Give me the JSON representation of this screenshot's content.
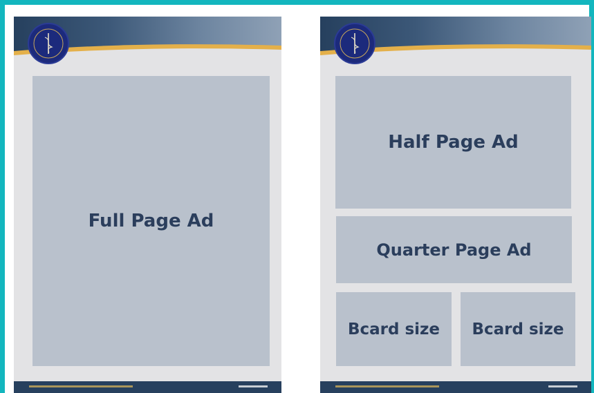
{
  "ads": {
    "full_page": "Full Page Ad",
    "half_page": "Half Page Ad",
    "quarter_page": "Quarter Page Ad",
    "bcard_left": "Bcard size",
    "bcard_right": "Bcard size"
  },
  "colors": {
    "frame": "#13b6be",
    "header_dark": "#26405e",
    "accent_gold": "#e4b04a",
    "ad_fill": "#b9c1cc",
    "ad_text": "#2b3e5c",
    "logo": "#1c2a7c"
  },
  "icons": {
    "logo": "medical-staff-logo-icon"
  }
}
